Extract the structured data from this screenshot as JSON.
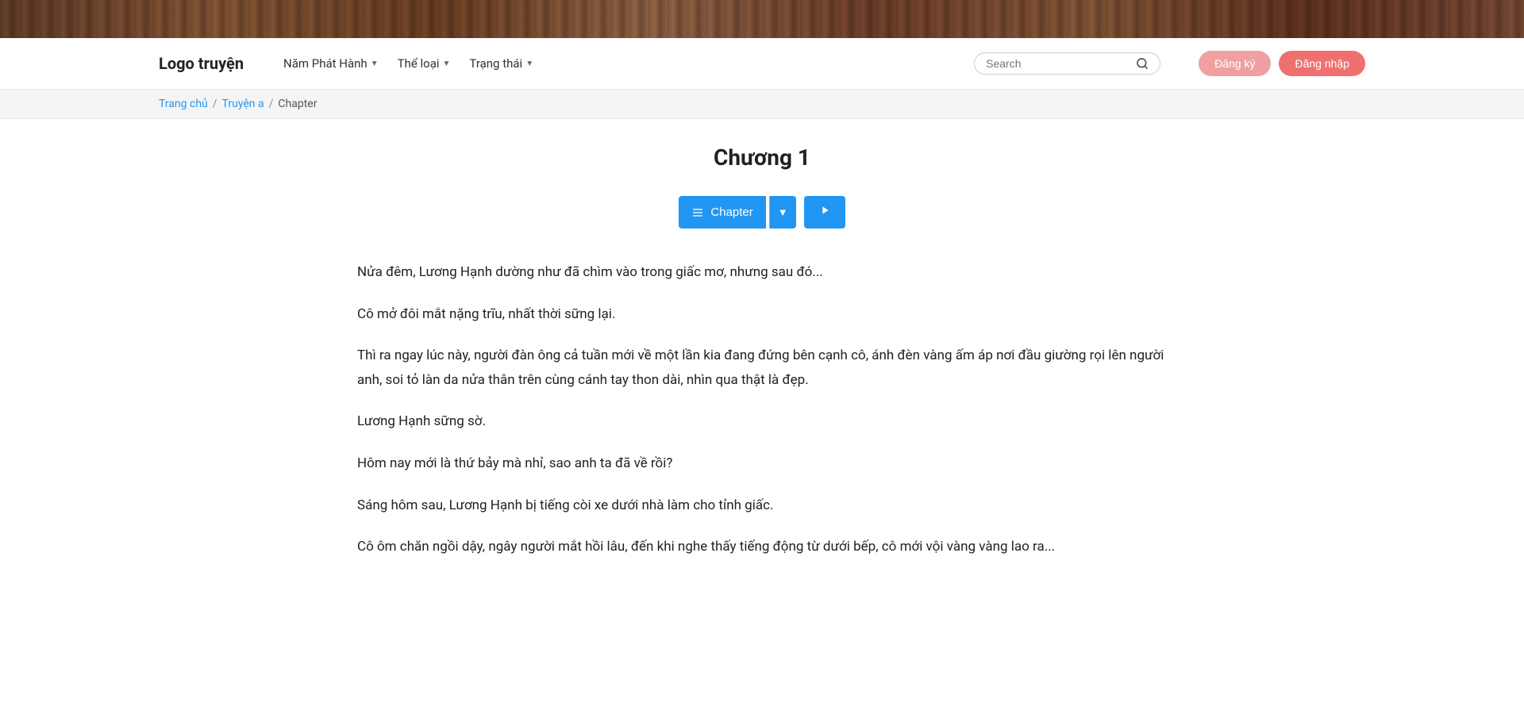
{
  "hero": {
    "alt": "Book shelf banner"
  },
  "navbar": {
    "logo": "Logo truyện",
    "menu": [
      {
        "label": "Năm Phát Hành",
        "has_caret": true
      },
      {
        "label": "Thể loại",
        "has_caret": true
      },
      {
        "label": "Trạng thái",
        "has_caret": true
      }
    ],
    "search_placeholder": "Search",
    "btn_register": "Đăng ký",
    "btn_login": "Đăng nhập"
  },
  "breadcrumb": {
    "home": "Trang chủ",
    "story": "Truyện a",
    "current": "Chapter"
  },
  "chapter": {
    "title": "Chương 1",
    "btn_chapter": "Chapter",
    "paragraphs": [
      "Nửa đêm, Lương Hạnh dường như đã chìm vào trong giấc mơ, nhưng sau đó...",
      "Cô mở đôi mắt nặng trĩu, nhất thời sững lại.",
      "Thì ra ngay lúc này, người đàn ông cả tuần mới về một lần kia đang đứng bên cạnh cô, ánh đèn vàng ấm áp nơi đầu giường rọi lên người anh, soi tỏ làn da nửa thân trên cùng cánh tay thon dài, nhìn qua thật là đẹp.",
      "Lương Hạnh sững sờ.",
      "Hôm nay mới là thứ bảy mà nhỉ, sao anh ta đã về rồi?",
      "Sáng hôm sau, Lương Hạnh bị tiếng còi xe dưới nhà làm cho tỉnh giấc.",
      "Cô ôm chăn ngồi dậy, ngây người mắt hồi lâu, đến khi nghe thấy tiếng động từ dưới bếp, cô mới vội vàng vàng lao ra..."
    ]
  }
}
